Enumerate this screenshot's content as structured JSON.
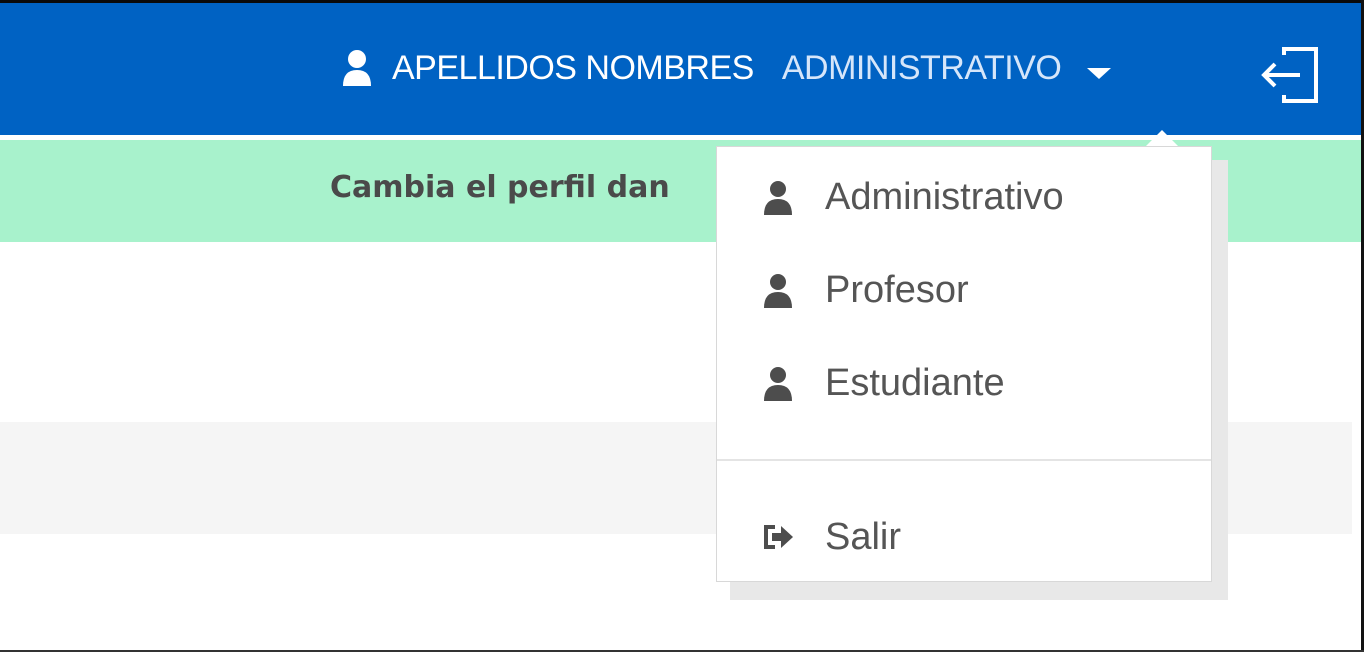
{
  "header": {
    "user_name": "APELLIDOS NOMBRES",
    "user_role": "ADMINISTRATIVO",
    "user_icon": "user-icon",
    "caret_icon": "caret-down-icon",
    "logout_icon": "logout-icon",
    "background_color": "#0062c3"
  },
  "notice": {
    "text": "Cambia el perfil dan",
    "background_color": "#a8f2cc"
  },
  "dropdown": {
    "items": [
      {
        "label": "Administrativo",
        "icon": "user-icon"
      },
      {
        "label": "Profesor",
        "icon": "user-icon"
      },
      {
        "label": "Estudiante",
        "icon": "user-icon"
      }
    ],
    "signout": {
      "label": "Salir",
      "icon": "sign-out-icon"
    }
  }
}
